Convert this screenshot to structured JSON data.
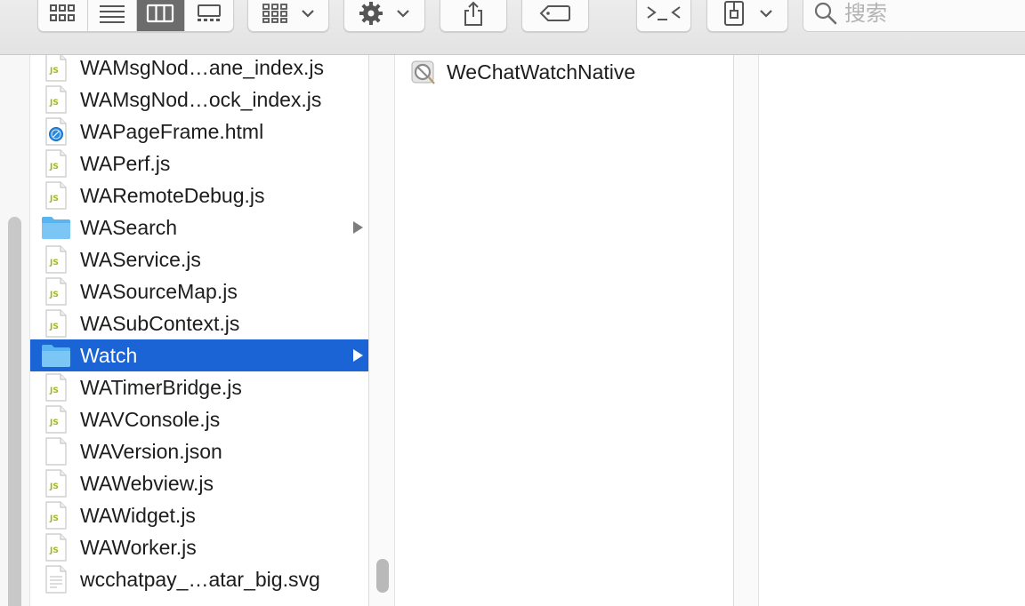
{
  "toolbar": {
    "view_modes": [
      "icon-view",
      "list-view",
      "column-view",
      "gallery-view"
    ],
    "active_view": "column-view",
    "search_placeholder": "搜索"
  },
  "colors": {
    "selection": "#1a64d5",
    "folder": "#5ab4f0",
    "js_badge": "#a0b32a"
  },
  "column1": {
    "items": [
      {
        "name": "WAMsgNod…ane_index.js",
        "icon": "js-file-icon"
      },
      {
        "name": "WAMsgNod…ock_index.js",
        "icon": "js-file-icon"
      },
      {
        "name": "WAPageFrame.html",
        "icon": "html-file-icon"
      },
      {
        "name": "WAPerf.js",
        "icon": "js-file-icon"
      },
      {
        "name": "WARemoteDebug.js",
        "icon": "js-file-icon"
      },
      {
        "name": "WASearch",
        "icon": "folder-icon",
        "folder": true
      },
      {
        "name": "WAService.js",
        "icon": "js-file-icon"
      },
      {
        "name": "WASourceMap.js",
        "icon": "js-file-icon"
      },
      {
        "name": "WASubContext.js",
        "icon": "js-file-icon"
      },
      {
        "name": "Watch",
        "icon": "folder-icon",
        "folder": true,
        "selected": true
      },
      {
        "name": "WATimerBridge.js",
        "icon": "js-file-icon"
      },
      {
        "name": "WAVConsole.js",
        "icon": "js-file-icon"
      },
      {
        "name": "WAVersion.json",
        "icon": "blank-file-icon"
      },
      {
        "name": "WAWebview.js",
        "icon": "js-file-icon"
      },
      {
        "name": "WAWidget.js",
        "icon": "js-file-icon"
      },
      {
        "name": "WAWorker.js",
        "icon": "js-file-icon"
      },
      {
        "name": "wcchatpay_…atar_big.svg",
        "icon": "text-file-icon"
      }
    ]
  },
  "column2": {
    "items": [
      {
        "name": "WeChatWatchNative",
        "icon": "prohibited-app-icon"
      }
    ]
  }
}
